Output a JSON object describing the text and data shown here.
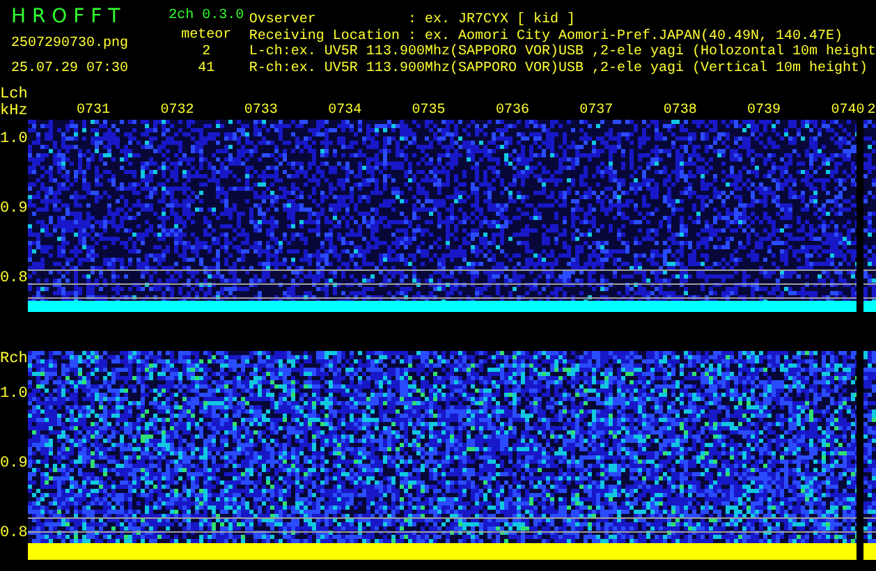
{
  "header": {
    "app_name": "H R O F F T",
    "version": "2ch 0.3.0",
    "file_name": "2507290730.png",
    "timestamp": "25.07.29 07:30",
    "meteor_label": "meteor",
    "meteor_counts": [
      "2",
      "41"
    ],
    "info_lines": [
      "Ovserver           : ex. JR7CYX [ kid ]",
      "Receiving Location : ex. Aomori City Aomori-Pref.JAPAN(40.49N, 140.47E)",
      "L-ch:ex. UV5R 113.900Mhz(SAPPORO VOR)USB ,2-ele yagi (Holozontal 10m height",
      "R-ch:ex. UV5R 113.900Mhz(SAPPORO VOR)USB ,2-ele yagi (Vertical 10m height)"
    ]
  },
  "channels": [
    {
      "label": "Lch",
      "unit": "kHz",
      "kind": "sparse",
      "time_labels": [
        "0731",
        "0732",
        "0733",
        "0734",
        "0735",
        "0736",
        "0737",
        "0738",
        "0739",
        "0740"
      ],
      "time_label_cut": "2",
      "y_labels": [
        "1.0",
        "0.9",
        "0.8"
      ]
    },
    {
      "label": "Rch",
      "kind": "dense",
      "y_labels": [
        "1.0",
        "0.9",
        "0.8"
      ]
    }
  ]
}
